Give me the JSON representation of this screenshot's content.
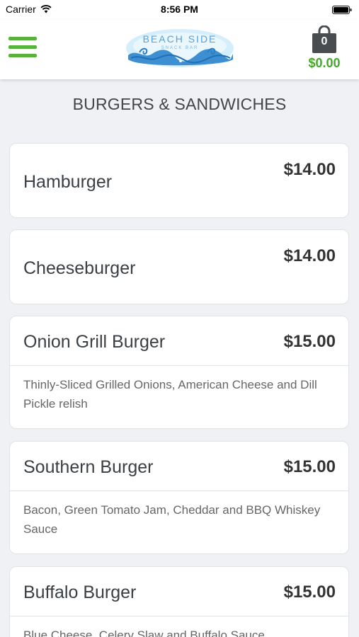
{
  "status_bar": {
    "carrier": "Carrier",
    "time": "8:56 PM"
  },
  "header": {
    "menu_icon": "hamburger-menu-icon",
    "logo": {
      "line1": "BEACH SIDE",
      "line2": "SNACK BAR"
    },
    "cart": {
      "count": "0",
      "total": "$0.00",
      "icon": "shopping-bag-icon"
    }
  },
  "section": {
    "title": "BURGERS & SANDWICHES"
  },
  "menu_items": [
    {
      "name": "Hamburger",
      "price": "$14.00",
      "description": ""
    },
    {
      "name": "Cheeseburger",
      "price": "$14.00",
      "description": ""
    },
    {
      "name": "Onion Grill Burger",
      "price": "$15.00",
      "description": "Thinly-Sliced Grilled Onions, American Cheese and Dill Pickle relish"
    },
    {
      "name": "Southern Burger",
      "price": "$15.00",
      "description": "Bacon, Green Tomato Jam, Cheddar and BBQ Whiskey Sauce"
    },
    {
      "name": "Buffalo Burger",
      "price": "$15.00",
      "description": "Blue Cheese, Celery Slaw and Buffalo Sauce"
    }
  ],
  "colors": {
    "accent_green": "#58b33a",
    "price_green": "#45a829",
    "background": "#eff1f4",
    "logo_blue": "#3d8fd1"
  }
}
